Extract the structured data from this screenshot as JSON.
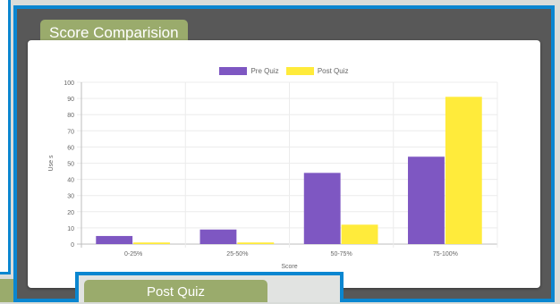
{
  "panel": {
    "title": "Score Comparision"
  },
  "bottom_window": {
    "title": "Post Quiz"
  },
  "colors": {
    "pre_quiz": "#7e57c2",
    "post_quiz": "#ffeb3b",
    "accent_blue": "#0a86d0",
    "tab_olive": "#9aab6c"
  },
  "chart_data": {
    "type": "bar",
    "categories": [
      "0-25%",
      "25-50%",
      "50-75%",
      "75-100%"
    ],
    "series": [
      {
        "name": "Pre Quiz",
        "values": [
          5,
          9,
          44,
          54
        ]
      },
      {
        "name": "Post Quiz",
        "values": [
          1,
          1,
          12,
          91
        ]
      }
    ],
    "xlabel": "Score",
    "ylabel": "Use s",
    "ylim": [
      0,
      100
    ],
    "yticks": [
      0,
      10,
      20,
      30,
      40,
      50,
      60,
      70,
      80,
      90,
      100
    ],
    "grid": true,
    "legend_position": "top"
  }
}
